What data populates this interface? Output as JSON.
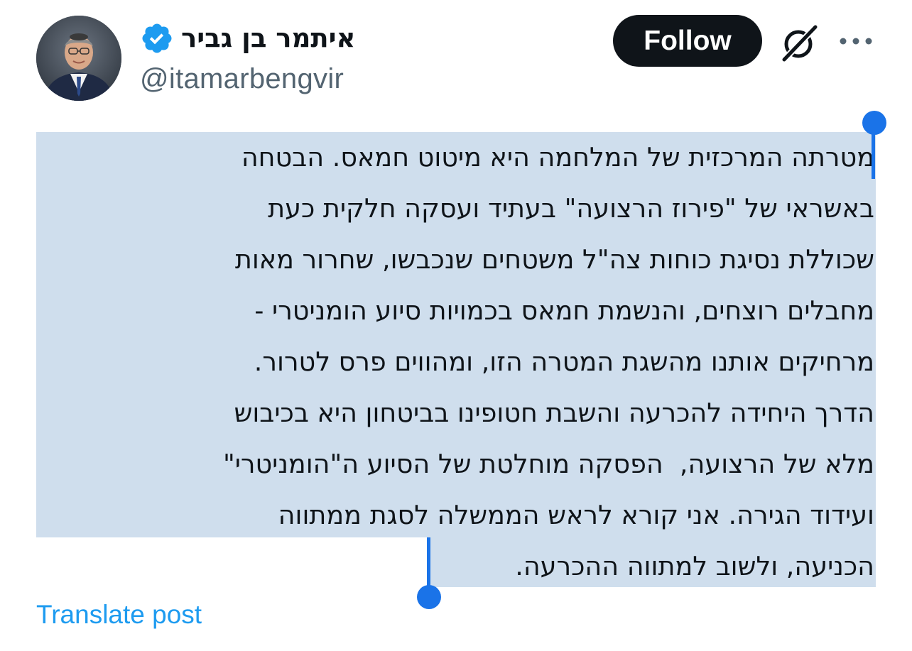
{
  "author": {
    "display_name": "איתמר בן גביר",
    "handle": "@itamarbengvir",
    "verified_icon": "verified-badge-icon"
  },
  "actions": {
    "follow_label": "Follow",
    "grok_icon": "grok-icon",
    "more_icon": "more-options-icon"
  },
  "post": {
    "lines": [
      "מטרתה המרכזית של המלחמה היא מיטוט חמאס. הבטחה",
      "באשראי של \"פירוז הרצועה\" בעתיד ועסקה חלקית כעת",
      "שכוללת נסיגת כוחות צה\"ל משטחים שנכבשו, שחרור מאות",
      "מחבלים רוצחים, והנשמת חמאס בכמויות סיוע הומניטרי -",
      "מרחיקים אותנו מהשגת המטרה הזו, ומהווים פרס לטרור.",
      "הדרך היחידה להכרעה והשבת חטופינו בביטחון היא בכיבוש",
      "מלא של הרצועה,  הפסקה מוחלטת של הסיוע ה\"הומניטרי\"",
      "ועידוד הגירה. אני קורא לראש הממשלה לסגת ממתווה",
      "הכניעה, ולשוב למתווה ההכרעה."
    ],
    "translate_label": "Translate post"
  },
  "colors": {
    "follow_bg": "#0f1419",
    "verified": "#1d9bf0",
    "selection_highlight": "#cfdeed",
    "selection_handle": "#1a73e8",
    "link": "#1d9bf0",
    "handle_text": "#536471"
  }
}
